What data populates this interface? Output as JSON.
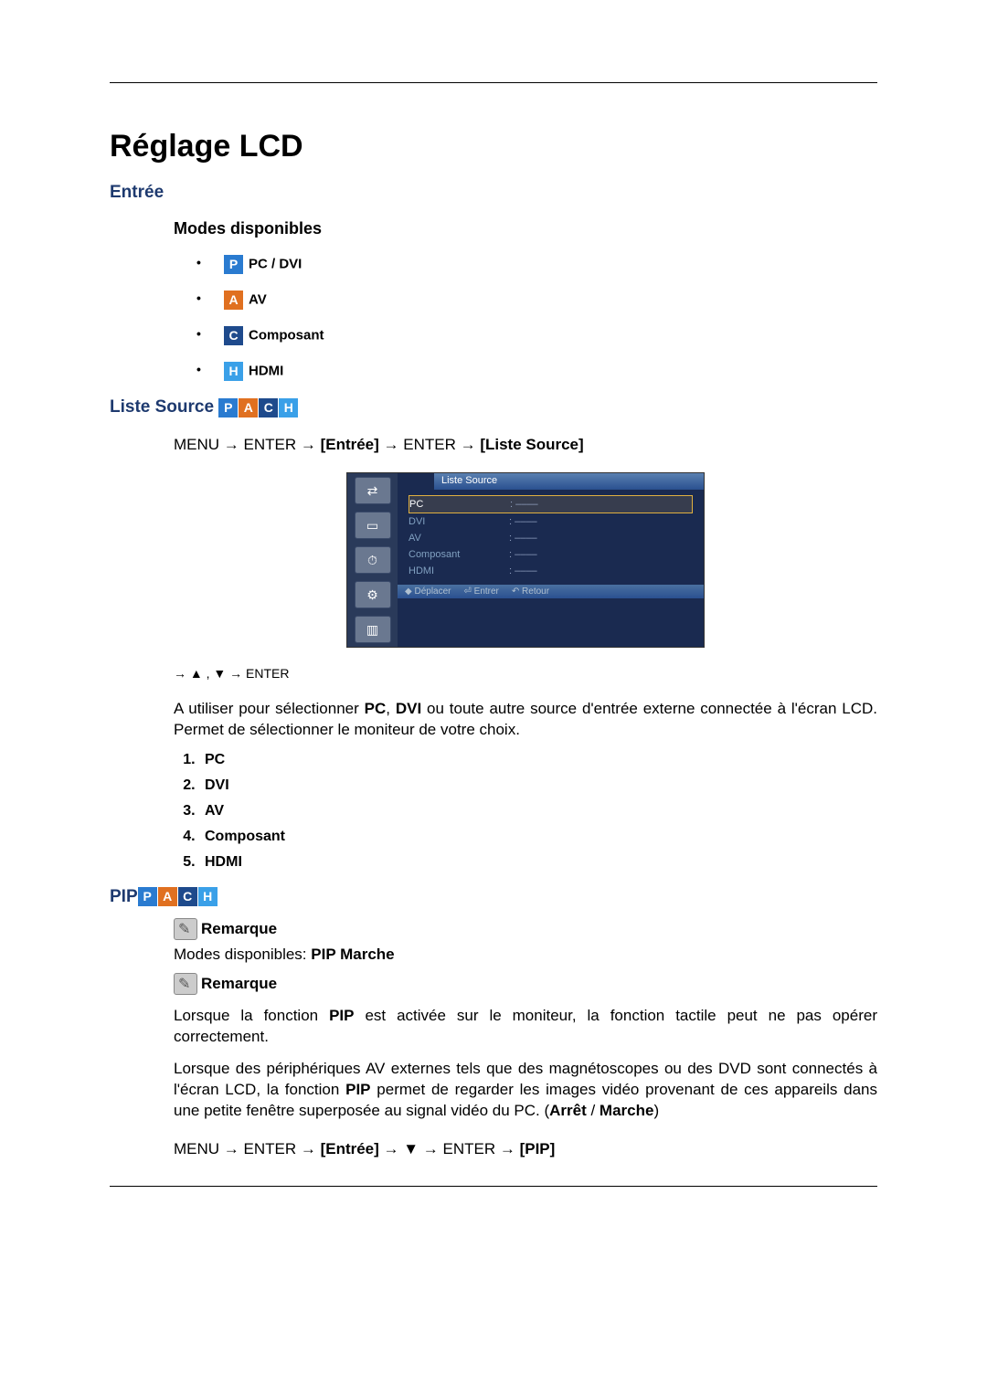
{
  "title": "Réglage LCD",
  "section1": "Entrée",
  "modes_title": "Modes disponibles",
  "modes": [
    {
      "badge": "P",
      "label": "PC / DVI"
    },
    {
      "badge": "A",
      "label": "AV"
    },
    {
      "badge": "C",
      "label": "Composant"
    },
    {
      "badge": "H",
      "label": "HDMI"
    }
  ],
  "liste_source": {
    "heading": "Liste Source",
    "nav_prefix": "MENU → ENTER → ",
    "nav_b1": "[Entrée]",
    "nav_mid": " → ENTER → ",
    "nav_b2": "[Liste Source]",
    "osd_title": "Liste Source",
    "osd_rows": [
      {
        "lbl": "PC",
        "val": ": ‒‒‒‒",
        "sel": true
      },
      {
        "lbl": "DVI",
        "val": ": ‒‒‒‒",
        "sel": false
      },
      {
        "lbl": "AV",
        "val": ": ‒‒‒‒",
        "sel": false
      },
      {
        "lbl": "Composant",
        "val": ": ‒‒‒‒",
        "sel": false
      },
      {
        "lbl": "HDMI",
        "val": ": ‒‒‒‒",
        "sel": false
      }
    ],
    "osd_footer": [
      "◆ Déplacer",
      "⏎ Entrer",
      "↶ Retour"
    ],
    "after_nav": "→ ▲ , ▼ → ENTER",
    "desc_pre": "A utiliser pour sélectionner ",
    "desc_b1": "PC",
    "desc_mid1": ", ",
    "desc_b2": "DVI",
    "desc_post": " ou toute autre source d'entrée externe connectée à l'écran LCD. Permet de sélectionner le moniteur de votre choix.",
    "list": [
      "PC",
      "DVI",
      "AV",
      "Composant",
      "HDMI"
    ]
  },
  "pip": {
    "heading": "PIP",
    "note_label": "Remarque",
    "modes_text_pre": "Modes disponibles: ",
    "modes_text_b": "PIP Marche",
    "para1_pre": "Lorsque la fonction ",
    "para1_b": "PIP",
    "para1_post": " est activée sur le moniteur, la fonction tactile peut ne pas opérer correctement.",
    "para2_pre": "Lorsque des périphériques AV externes tels que des magnétoscopes ou des DVD sont connectés à l'écran LCD, la fonction ",
    "para2_b1": "PIP",
    "para2_mid": " permet de regarder les images vidéo provenant de ces appareils dans une petite fenêtre superposée au signal vidéo du PC. (",
    "para2_b2": "Arrêt",
    "para2_slash": " / ",
    "para2_b3": "Marche",
    "para2_end": ")",
    "nav_prefix": "MENU → ENTER → ",
    "nav_b1": "[Entrée]",
    "nav_mid1": " → ▼ → ENTER → ",
    "nav_b2": "[PIP]"
  }
}
